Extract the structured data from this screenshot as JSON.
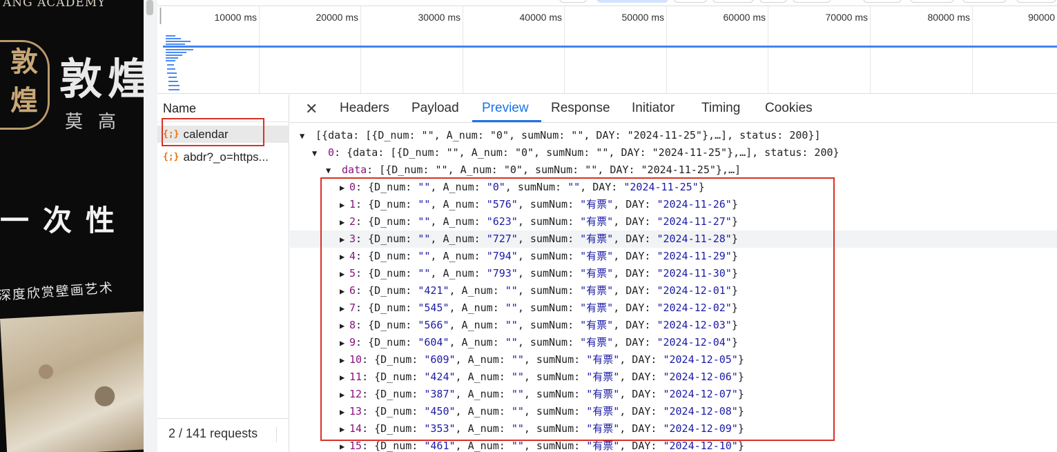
{
  "page": {
    "academy_text": "ANG ACADEMY",
    "seal_text": "敦煌",
    "big_title": "敦煌",
    "sub_title": "莫高",
    "slogan": "一次性",
    "tagline": "深度欣赏壁画艺术"
  },
  "overview": {
    "ticks": [
      "10000 ms",
      "20000 ms",
      "30000 ms",
      "40000 ms",
      "50000 ms",
      "60000 ms",
      "70000 ms",
      "80000 ms",
      "90000"
    ]
  },
  "name_pane": {
    "header": "Name",
    "requests": [
      {
        "icon": "{;}",
        "label": "calendar"
      },
      {
        "icon": "{;}",
        "label": "abdr?_o=https..."
      }
    ],
    "footer": "2 / 141 requests"
  },
  "tabs": {
    "close": "✕",
    "items": [
      "Headers",
      "Payload",
      "Preview",
      "Response",
      "Initiator",
      "Timing",
      "Cookies"
    ],
    "active": "Preview"
  },
  "preview": {
    "root_summary": "[{data: [{D_num: \"\", A_num: \"0\", sumNum: \"\", DAY: \"2024-11-25\"},…], status: 200}]",
    "item0_key": "0",
    "item0_summary": "{data: [{D_num: \"\", A_num: \"0\", sumNum: \"\", DAY: \"2024-11-25\"},…], status: 200}",
    "data_key": "data",
    "data_summary": "[{D_num: \"\", A_num: \"0\", sumNum: \"\", DAY: \"2024-11-25\"},…]",
    "rows": [
      {
        "key": "0",
        "D_num": "\"\"",
        "A_num": "\"0\"",
        "sumNum": "\"\"",
        "DAY": "\"2024-11-25\""
      },
      {
        "key": "1",
        "D_num": "\"\"",
        "A_num": "\"576\"",
        "sumNum": "\"有票\"",
        "DAY": "\"2024-11-26\""
      },
      {
        "key": "2",
        "D_num": "\"\"",
        "A_num": "\"623\"",
        "sumNum": "\"有票\"",
        "DAY": "\"2024-11-27\""
      },
      {
        "key": "3",
        "D_num": "\"\"",
        "A_num": "\"727\"",
        "sumNum": "\"有票\"",
        "DAY": "\"2024-11-28\""
      },
      {
        "key": "4",
        "D_num": "\"\"",
        "A_num": "\"794\"",
        "sumNum": "\"有票\"",
        "DAY": "\"2024-11-29\""
      },
      {
        "key": "5",
        "D_num": "\"\"",
        "A_num": "\"793\"",
        "sumNum": "\"有票\"",
        "DAY": "\"2024-11-30\""
      },
      {
        "key": "6",
        "D_num": "\"421\"",
        "A_num": "\"\"",
        "sumNum": "\"有票\"",
        "DAY": "\"2024-12-01\""
      },
      {
        "key": "7",
        "D_num": "\"545\"",
        "A_num": "\"\"",
        "sumNum": "\"有票\"",
        "DAY": "\"2024-12-02\""
      },
      {
        "key": "8",
        "D_num": "\"566\"",
        "A_num": "\"\"",
        "sumNum": "\"有票\"",
        "DAY": "\"2024-12-03\""
      },
      {
        "key": "9",
        "D_num": "\"604\"",
        "A_num": "\"\"",
        "sumNum": "\"有票\"",
        "DAY": "\"2024-12-04\""
      },
      {
        "key": "10",
        "D_num": "\"609\"",
        "A_num": "\"\"",
        "sumNum": "\"有票\"",
        "DAY": "\"2024-12-05\""
      },
      {
        "key": "11",
        "D_num": "\"424\"",
        "A_num": "\"\"",
        "sumNum": "\"有票\"",
        "DAY": "\"2024-12-06\""
      },
      {
        "key": "12",
        "D_num": "\"387\"",
        "A_num": "\"\"",
        "sumNum": "\"有票\"",
        "DAY": "\"2024-12-07\""
      },
      {
        "key": "13",
        "D_num": "\"450\"",
        "A_num": "\"\"",
        "sumNum": "\"有票\"",
        "DAY": "\"2024-12-08\""
      },
      {
        "key": "14",
        "D_num": "\"353\"",
        "A_num": "\"\"",
        "sumNum": "\"有票\"",
        "DAY": "\"2024-12-09\""
      },
      {
        "key": "15",
        "D_num": "\"461\"",
        "A_num": "\"\"",
        "sumNum": "\"有票\"",
        "DAY": "\"2024-12-10\""
      }
    ]
  },
  "colors": {
    "accent": "#1a73e8",
    "highlight": "#d93025",
    "json_key": "#881280",
    "json_string": "#1a1aa6",
    "request_icon": "#e8710a"
  }
}
